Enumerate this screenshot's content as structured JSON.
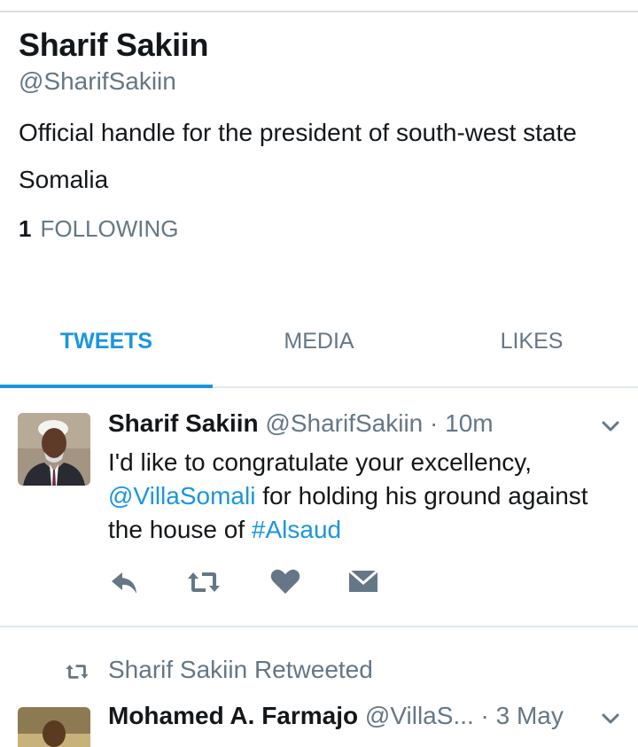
{
  "profile": {
    "name": "Sharif Sakiin",
    "handle": "@SharifSakiin",
    "bio": "Official handle for the president of south-west state",
    "location": "Somalia",
    "following_count": "1",
    "following_label": "FOLLOWING"
  },
  "tabs": [
    {
      "label": "TWEETS",
      "active": true
    },
    {
      "label": "MEDIA",
      "active": false
    },
    {
      "label": "LIKES",
      "active": false
    }
  ],
  "tweets": [
    {
      "author": "Sharif Sakiin",
      "handle": "@SharifSakiin",
      "time": "· 10m",
      "text_1": "I'd like to congratulate your excellency,",
      "mention": "@VillaSomali",
      "text_2": " for holding his ground against the house of ",
      "hashtag": "#Alsaud"
    },
    {
      "retweeted_by": "Sharif Sakiin Retweeted",
      "author": "Mohamed A. Farmajo",
      "handle": "@VillaS...",
      "time": "· 3 May"
    }
  ],
  "icons": {
    "reply": "reply-icon",
    "retweet": "retweet-icon",
    "like": "heart-icon",
    "message": "direct-message-icon",
    "menu": "chevron-down-icon"
  },
  "colors": {
    "accent": "#1b95e0",
    "muted": "#657786",
    "text": "#14171a",
    "divider": "#e1e8ed"
  }
}
